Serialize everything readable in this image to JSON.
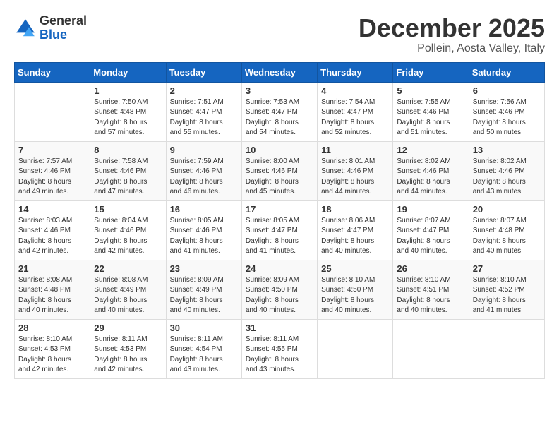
{
  "header": {
    "logo_general": "General",
    "logo_blue": "Blue",
    "month_year": "December 2025",
    "location": "Pollein, Aosta Valley, Italy"
  },
  "weekdays": [
    "Sunday",
    "Monday",
    "Tuesday",
    "Wednesday",
    "Thursday",
    "Friday",
    "Saturday"
  ],
  "weeks": [
    [
      {
        "day": "",
        "content": ""
      },
      {
        "day": "1",
        "content": "Sunrise: 7:50 AM\nSunset: 4:48 PM\nDaylight: 8 hours\nand 57 minutes."
      },
      {
        "day": "2",
        "content": "Sunrise: 7:51 AM\nSunset: 4:47 PM\nDaylight: 8 hours\nand 55 minutes."
      },
      {
        "day": "3",
        "content": "Sunrise: 7:53 AM\nSunset: 4:47 PM\nDaylight: 8 hours\nand 54 minutes."
      },
      {
        "day": "4",
        "content": "Sunrise: 7:54 AM\nSunset: 4:47 PM\nDaylight: 8 hours\nand 52 minutes."
      },
      {
        "day": "5",
        "content": "Sunrise: 7:55 AM\nSunset: 4:46 PM\nDaylight: 8 hours\nand 51 minutes."
      },
      {
        "day": "6",
        "content": "Sunrise: 7:56 AM\nSunset: 4:46 PM\nDaylight: 8 hours\nand 50 minutes."
      }
    ],
    [
      {
        "day": "7",
        "content": "Sunrise: 7:57 AM\nSunset: 4:46 PM\nDaylight: 8 hours\nand 49 minutes."
      },
      {
        "day": "8",
        "content": "Sunrise: 7:58 AM\nSunset: 4:46 PM\nDaylight: 8 hours\nand 47 minutes."
      },
      {
        "day": "9",
        "content": "Sunrise: 7:59 AM\nSunset: 4:46 PM\nDaylight: 8 hours\nand 46 minutes."
      },
      {
        "day": "10",
        "content": "Sunrise: 8:00 AM\nSunset: 4:46 PM\nDaylight: 8 hours\nand 45 minutes."
      },
      {
        "day": "11",
        "content": "Sunrise: 8:01 AM\nSunset: 4:46 PM\nDaylight: 8 hours\nand 44 minutes."
      },
      {
        "day": "12",
        "content": "Sunrise: 8:02 AM\nSunset: 4:46 PM\nDaylight: 8 hours\nand 44 minutes."
      },
      {
        "day": "13",
        "content": "Sunrise: 8:02 AM\nSunset: 4:46 PM\nDaylight: 8 hours\nand 43 minutes."
      }
    ],
    [
      {
        "day": "14",
        "content": "Sunrise: 8:03 AM\nSunset: 4:46 PM\nDaylight: 8 hours\nand 42 minutes."
      },
      {
        "day": "15",
        "content": "Sunrise: 8:04 AM\nSunset: 4:46 PM\nDaylight: 8 hours\nand 42 minutes."
      },
      {
        "day": "16",
        "content": "Sunrise: 8:05 AM\nSunset: 4:46 PM\nDaylight: 8 hours\nand 41 minutes."
      },
      {
        "day": "17",
        "content": "Sunrise: 8:05 AM\nSunset: 4:47 PM\nDaylight: 8 hours\nand 41 minutes."
      },
      {
        "day": "18",
        "content": "Sunrise: 8:06 AM\nSunset: 4:47 PM\nDaylight: 8 hours\nand 40 minutes."
      },
      {
        "day": "19",
        "content": "Sunrise: 8:07 AM\nSunset: 4:47 PM\nDaylight: 8 hours\nand 40 minutes."
      },
      {
        "day": "20",
        "content": "Sunrise: 8:07 AM\nSunset: 4:48 PM\nDaylight: 8 hours\nand 40 minutes."
      }
    ],
    [
      {
        "day": "21",
        "content": "Sunrise: 8:08 AM\nSunset: 4:48 PM\nDaylight: 8 hours\nand 40 minutes."
      },
      {
        "day": "22",
        "content": "Sunrise: 8:08 AM\nSunset: 4:49 PM\nDaylight: 8 hours\nand 40 minutes."
      },
      {
        "day": "23",
        "content": "Sunrise: 8:09 AM\nSunset: 4:49 PM\nDaylight: 8 hours\nand 40 minutes."
      },
      {
        "day": "24",
        "content": "Sunrise: 8:09 AM\nSunset: 4:50 PM\nDaylight: 8 hours\nand 40 minutes."
      },
      {
        "day": "25",
        "content": "Sunrise: 8:10 AM\nSunset: 4:50 PM\nDaylight: 8 hours\nand 40 minutes."
      },
      {
        "day": "26",
        "content": "Sunrise: 8:10 AM\nSunset: 4:51 PM\nDaylight: 8 hours\nand 40 minutes."
      },
      {
        "day": "27",
        "content": "Sunrise: 8:10 AM\nSunset: 4:52 PM\nDaylight: 8 hours\nand 41 minutes."
      }
    ],
    [
      {
        "day": "28",
        "content": "Sunrise: 8:10 AM\nSunset: 4:53 PM\nDaylight: 8 hours\nand 42 minutes."
      },
      {
        "day": "29",
        "content": "Sunrise: 8:11 AM\nSunset: 4:53 PM\nDaylight: 8 hours\nand 42 minutes."
      },
      {
        "day": "30",
        "content": "Sunrise: 8:11 AM\nSunset: 4:54 PM\nDaylight: 8 hours\nand 43 minutes."
      },
      {
        "day": "31",
        "content": "Sunrise: 8:11 AM\nSunset: 4:55 PM\nDaylight: 8 hours\nand 43 minutes."
      },
      {
        "day": "",
        "content": ""
      },
      {
        "day": "",
        "content": ""
      },
      {
        "day": "",
        "content": ""
      }
    ]
  ]
}
